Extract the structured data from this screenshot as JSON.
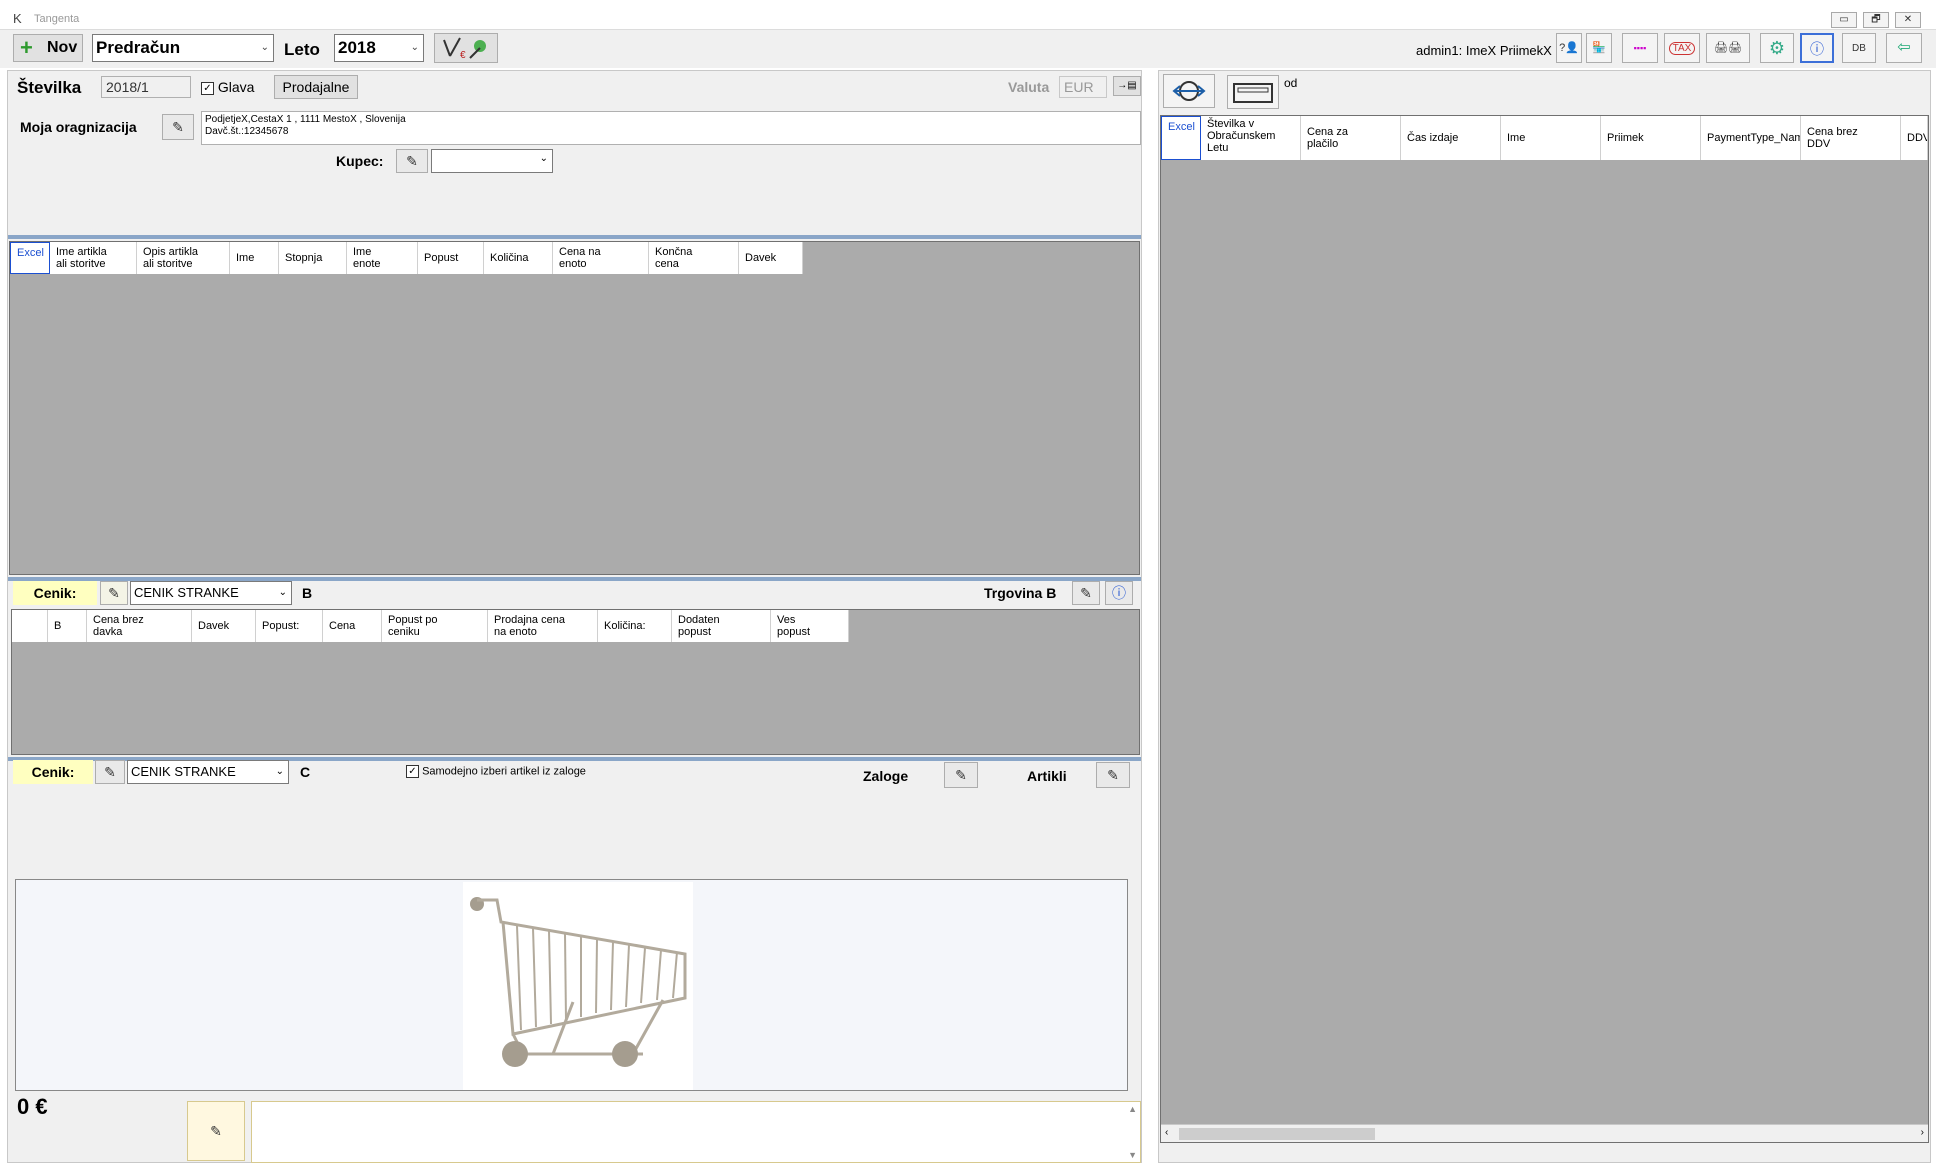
{
  "window": {
    "title": "Tangenta",
    "logo_glyph": "K",
    "min": "▭",
    "max": "🗗",
    "close": "✕"
  },
  "toolbar": {
    "new_label": "Nov",
    "doc_type": "Predračun",
    "year_label": "Leto",
    "year_value": "2018",
    "user_label": "admin1: ImeX PriimekX",
    "icons": [
      "help-icon",
      "shop-icon",
      "barcode-icon",
      "tax-icon",
      "printer-icon",
      "settings-icon",
      "info-icon",
      "database-icon",
      "logout-icon"
    ],
    "tax_text": "TAX",
    "db_text": "DB"
  },
  "header": {
    "number_label": "Številka",
    "number_value": "2018/1",
    "glava_label": "Glava",
    "prodajalne_label": "Prodajalne",
    "valuta_label": "Valuta",
    "valuta_value": "EUR",
    "org_label": "Moja oragnizacija",
    "org_line1": "PodjetjeX,CestaX 1 , 1111 MestoX , Slovenija",
    "org_line2": "Davč.št.:12345678",
    "kupec_label": "Kupec:"
  },
  "items_grid": {
    "excel": "Excel",
    "columns": [
      "Ime artikla\nali storitve",
      "Opis artikla\nali storitve",
      "Ime",
      "Stopnja",
      "Ime\nenote",
      "Popust",
      "Količina",
      "Cena na\nenoto",
      "Končna\ncena",
      "Davek"
    ]
  },
  "pricelist_b": {
    "label": "Cenik:",
    "value": "CENIK STRANKE",
    "suffix": "B",
    "shop_label": "Trgovina B",
    "columns": [
      "B",
      "Cena brez\ndavka",
      "Davek",
      "Popust:",
      "Cena",
      "Popust po\nceniku",
      "Prodajna cena\nna enoto",
      "Količina:",
      "Dodaten\npopust",
      "Ves\npopust"
    ]
  },
  "pricelist_c": {
    "label": "Cenik:",
    "value": "CENIK STRANKE",
    "suffix": "C",
    "auto_label": "Samodejno izberi artikel iz zaloge",
    "zaloge_label": "Zaloge",
    "artikli_label": "Artikli"
  },
  "footer": {
    "total": "0 €"
  },
  "right": {
    "od_label": "od",
    "excel": "Excel",
    "columns": [
      "Številka v\nObračunskem\nLetu",
      "Cena za\nplačilo",
      "Čas izdaje",
      "Ime",
      "Priimek",
      "PaymentType_Nam",
      "Cena brez\nDDV",
      "DDV"
    ]
  }
}
